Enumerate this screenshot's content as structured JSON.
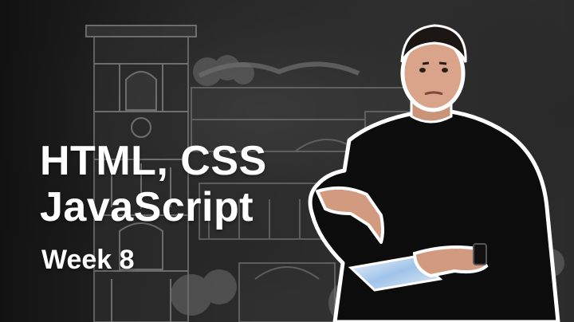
{
  "title": {
    "line1": "HTML, CSS",
    "line2": "JavaScript"
  },
  "subtitle": "Week 8",
  "colors": {
    "background": "#1a1a1a",
    "chalk": "#9a9a9a",
    "text": "#ffffff",
    "sweater": "#0c0c0c",
    "skin": "#d9a48a",
    "hair": "#1b1613",
    "paper": "#dbe8f5"
  }
}
